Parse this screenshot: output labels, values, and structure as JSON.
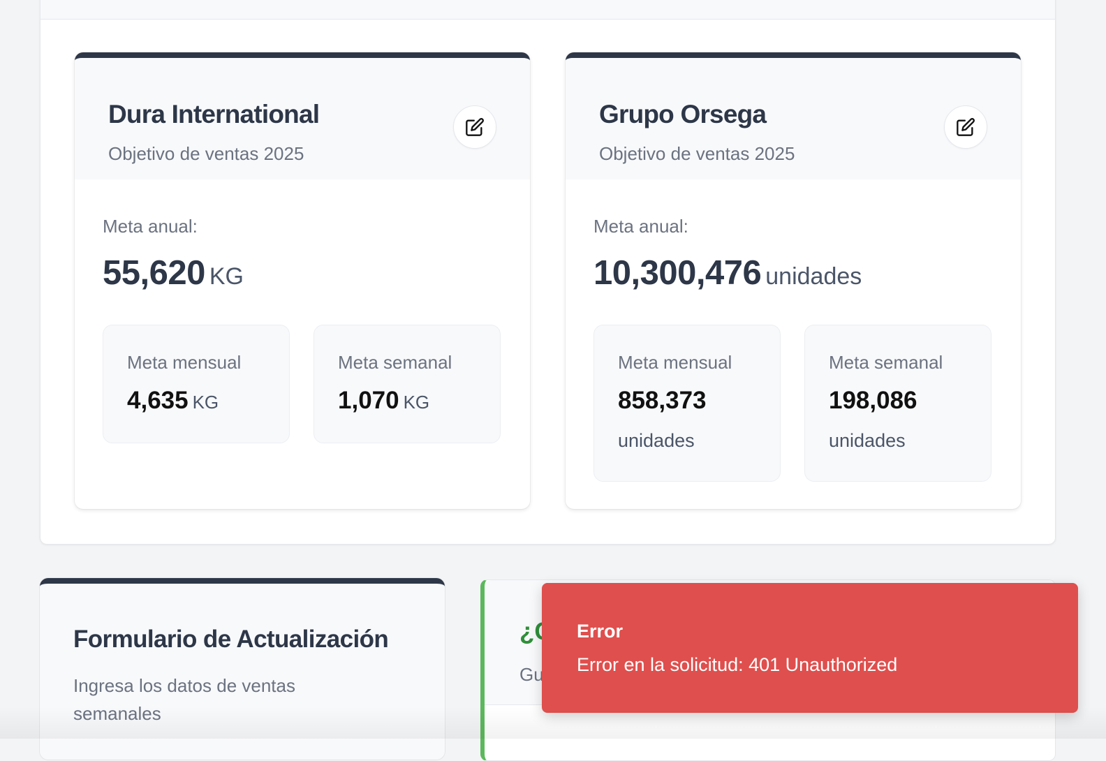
{
  "goal_cards": [
    {
      "company": "Dura International",
      "subtitle": "Objetivo de ventas 2025",
      "annual_label": "Meta anual:",
      "annual_value": "55,620",
      "annual_unit": "KG",
      "monthly_label": "Meta mensual",
      "monthly_value": "4,635",
      "monthly_unit": "KG",
      "weekly_label": "Meta semanal",
      "weekly_value": "1,070",
      "weekly_unit": "KG"
    },
    {
      "company": "Grupo Orsega",
      "subtitle": "Objetivo de ventas 2025",
      "annual_label": "Meta anual:",
      "annual_value": "10,300,476",
      "annual_unit": "unidades",
      "monthly_label": "Meta mensual",
      "monthly_value": "858,373",
      "monthly_unit": "unidades",
      "weekly_label": "Meta semanal",
      "weekly_value": "198,086",
      "weekly_unit": "unidades"
    }
  ],
  "form_card": {
    "title": "Formulario de Actualización",
    "subtitle": "Ingresa los datos de ventas semanales"
  },
  "question_card": {
    "title_partial": "¿C",
    "subtitle_partial": "Gu"
  },
  "toast": {
    "title": "Error",
    "message": "Error en la solicitud: 401 Unauthorized"
  },
  "colors": {
    "card_accent": "#2d3748",
    "success_accent": "#5cb85c",
    "error_bg": "#df4f4d"
  },
  "icons": {
    "edit": "edit-icon"
  }
}
